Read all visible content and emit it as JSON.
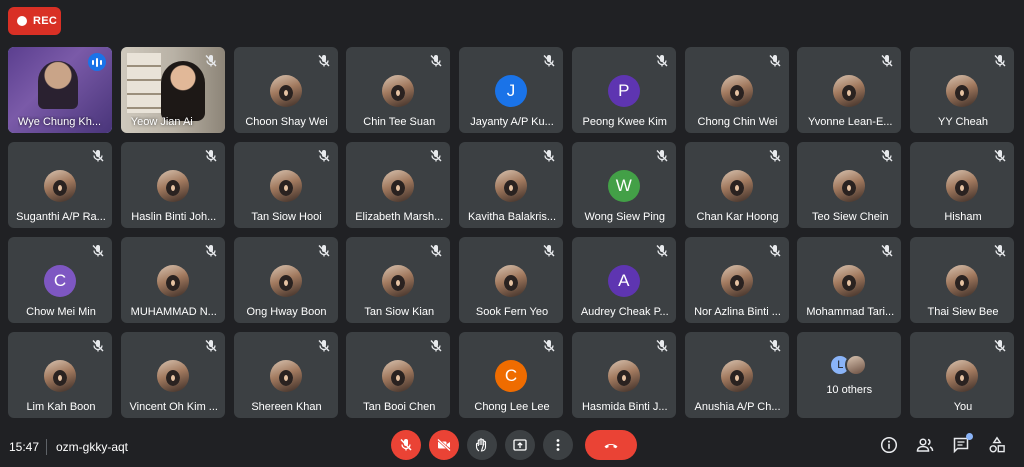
{
  "recording": {
    "label": "REC",
    "color": "#d93025"
  },
  "meeting": {
    "time": "15:47",
    "code": "ozm-gkky-aqt"
  },
  "colors": {
    "background": "#202124",
    "tile": "#3c4043",
    "speaking_outline": "#8ab4f8",
    "end_call": "#ea4335"
  },
  "tiles": [
    {
      "name": "Wye Chung Kh...",
      "kind": "video-wye",
      "speaking": true,
      "muted": false
    },
    {
      "name": "Yeow Jian Ai",
      "kind": "video-yeow",
      "speaking": false,
      "muted": true
    },
    {
      "name": "Choon Shay Wei",
      "kind": "photo",
      "muted": true
    },
    {
      "name": "Chin Tee Suan",
      "kind": "photo",
      "muted": true
    },
    {
      "name": "Jayanty A/P Ku...",
      "kind": "letter",
      "letter": "J",
      "color": "#1a73e8",
      "muted": true
    },
    {
      "name": "Peong Kwee Kim",
      "kind": "letter",
      "letter": "P",
      "color": "#5e35b1",
      "muted": true
    },
    {
      "name": "Chong Chin Wei",
      "kind": "photo",
      "muted": true
    },
    {
      "name": "Yvonne Lean-E...",
      "kind": "photo",
      "muted": true
    },
    {
      "name": "YY Cheah",
      "kind": "photo",
      "muted": true
    },
    {
      "name": "Suganthi A/P Ra...",
      "kind": "photo",
      "muted": true
    },
    {
      "name": "Haslin Binti Joh...",
      "kind": "photo",
      "muted": true
    },
    {
      "name": "Tan Siow Hooi",
      "kind": "photo",
      "muted": true
    },
    {
      "name": "Elizabeth Marsh...",
      "kind": "photo",
      "muted": true
    },
    {
      "name": "Kavitha Balakris...",
      "kind": "photo",
      "muted": true
    },
    {
      "name": "Wong Siew Ping",
      "kind": "letter",
      "letter": "W",
      "color": "#43a047",
      "muted": true
    },
    {
      "name": "Chan Kar Hoong",
      "kind": "photo",
      "muted": true
    },
    {
      "name": "Teo Siew Chein",
      "kind": "photo",
      "muted": true
    },
    {
      "name": "Hisham",
      "kind": "photo",
      "muted": true
    },
    {
      "name": "Chow Mei Min",
      "kind": "letter",
      "letter": "C",
      "color": "#7e57c2",
      "muted": true
    },
    {
      "name": "MUHAMMAD N...",
      "kind": "photo",
      "muted": true
    },
    {
      "name": "Ong Hway Boon",
      "kind": "photo",
      "muted": true
    },
    {
      "name": "Tan Siow Kian",
      "kind": "photo",
      "muted": true
    },
    {
      "name": "Sook Fern Yeo",
      "kind": "photo",
      "muted": true
    },
    {
      "name": "Audrey Cheak P...",
      "kind": "letter",
      "letter": "A",
      "color": "#5e35b1",
      "muted": true
    },
    {
      "name": "Nor Azlina Binti ...",
      "kind": "photo",
      "muted": true
    },
    {
      "name": "Mohammad Tari...",
      "kind": "photo",
      "muted": true
    },
    {
      "name": "Thai Siew Bee",
      "kind": "photo",
      "muted": true
    },
    {
      "name": "Lim Kah Boon",
      "kind": "photo",
      "muted": true
    },
    {
      "name": "Vincent Oh Kim ...",
      "kind": "photo",
      "muted": true
    },
    {
      "name": "Shereen Khan",
      "kind": "photo",
      "muted": true
    },
    {
      "name": "Tan Booi Chen",
      "kind": "photo",
      "muted": true
    },
    {
      "name": "Chong Lee Lee",
      "kind": "letter",
      "letter": "C",
      "color": "#ef6c00",
      "muted": true
    },
    {
      "name": "Hasmida Binti J...",
      "kind": "photo",
      "muted": true
    },
    {
      "name": "Anushia A/P Ch...",
      "kind": "photo",
      "muted": true
    },
    {
      "name": "10 others",
      "kind": "others",
      "letter": "L",
      "muted": false
    },
    {
      "name": "You",
      "kind": "photo",
      "muted": true
    }
  ],
  "controls": [
    {
      "name": "mic-toggle-button",
      "icon": "mic-off-icon",
      "red": true
    },
    {
      "name": "camera-toggle-button",
      "icon": "camera-off-icon",
      "red": true
    },
    {
      "name": "raise-hand-button",
      "icon": "hand-icon",
      "red": false
    },
    {
      "name": "present-screen-button",
      "icon": "present-icon",
      "red": false
    },
    {
      "name": "more-options-button",
      "icon": "more-vert-icon",
      "red": false
    },
    {
      "name": "leave-call-button",
      "icon": "phone-hangup-icon",
      "red": true
    }
  ],
  "right_controls": [
    {
      "name": "meeting-details-button",
      "icon": "info-icon"
    },
    {
      "name": "people-button",
      "icon": "people-icon"
    },
    {
      "name": "chat-button",
      "icon": "chat-icon",
      "badge": true
    },
    {
      "name": "activities-button",
      "icon": "activities-icon"
    }
  ]
}
